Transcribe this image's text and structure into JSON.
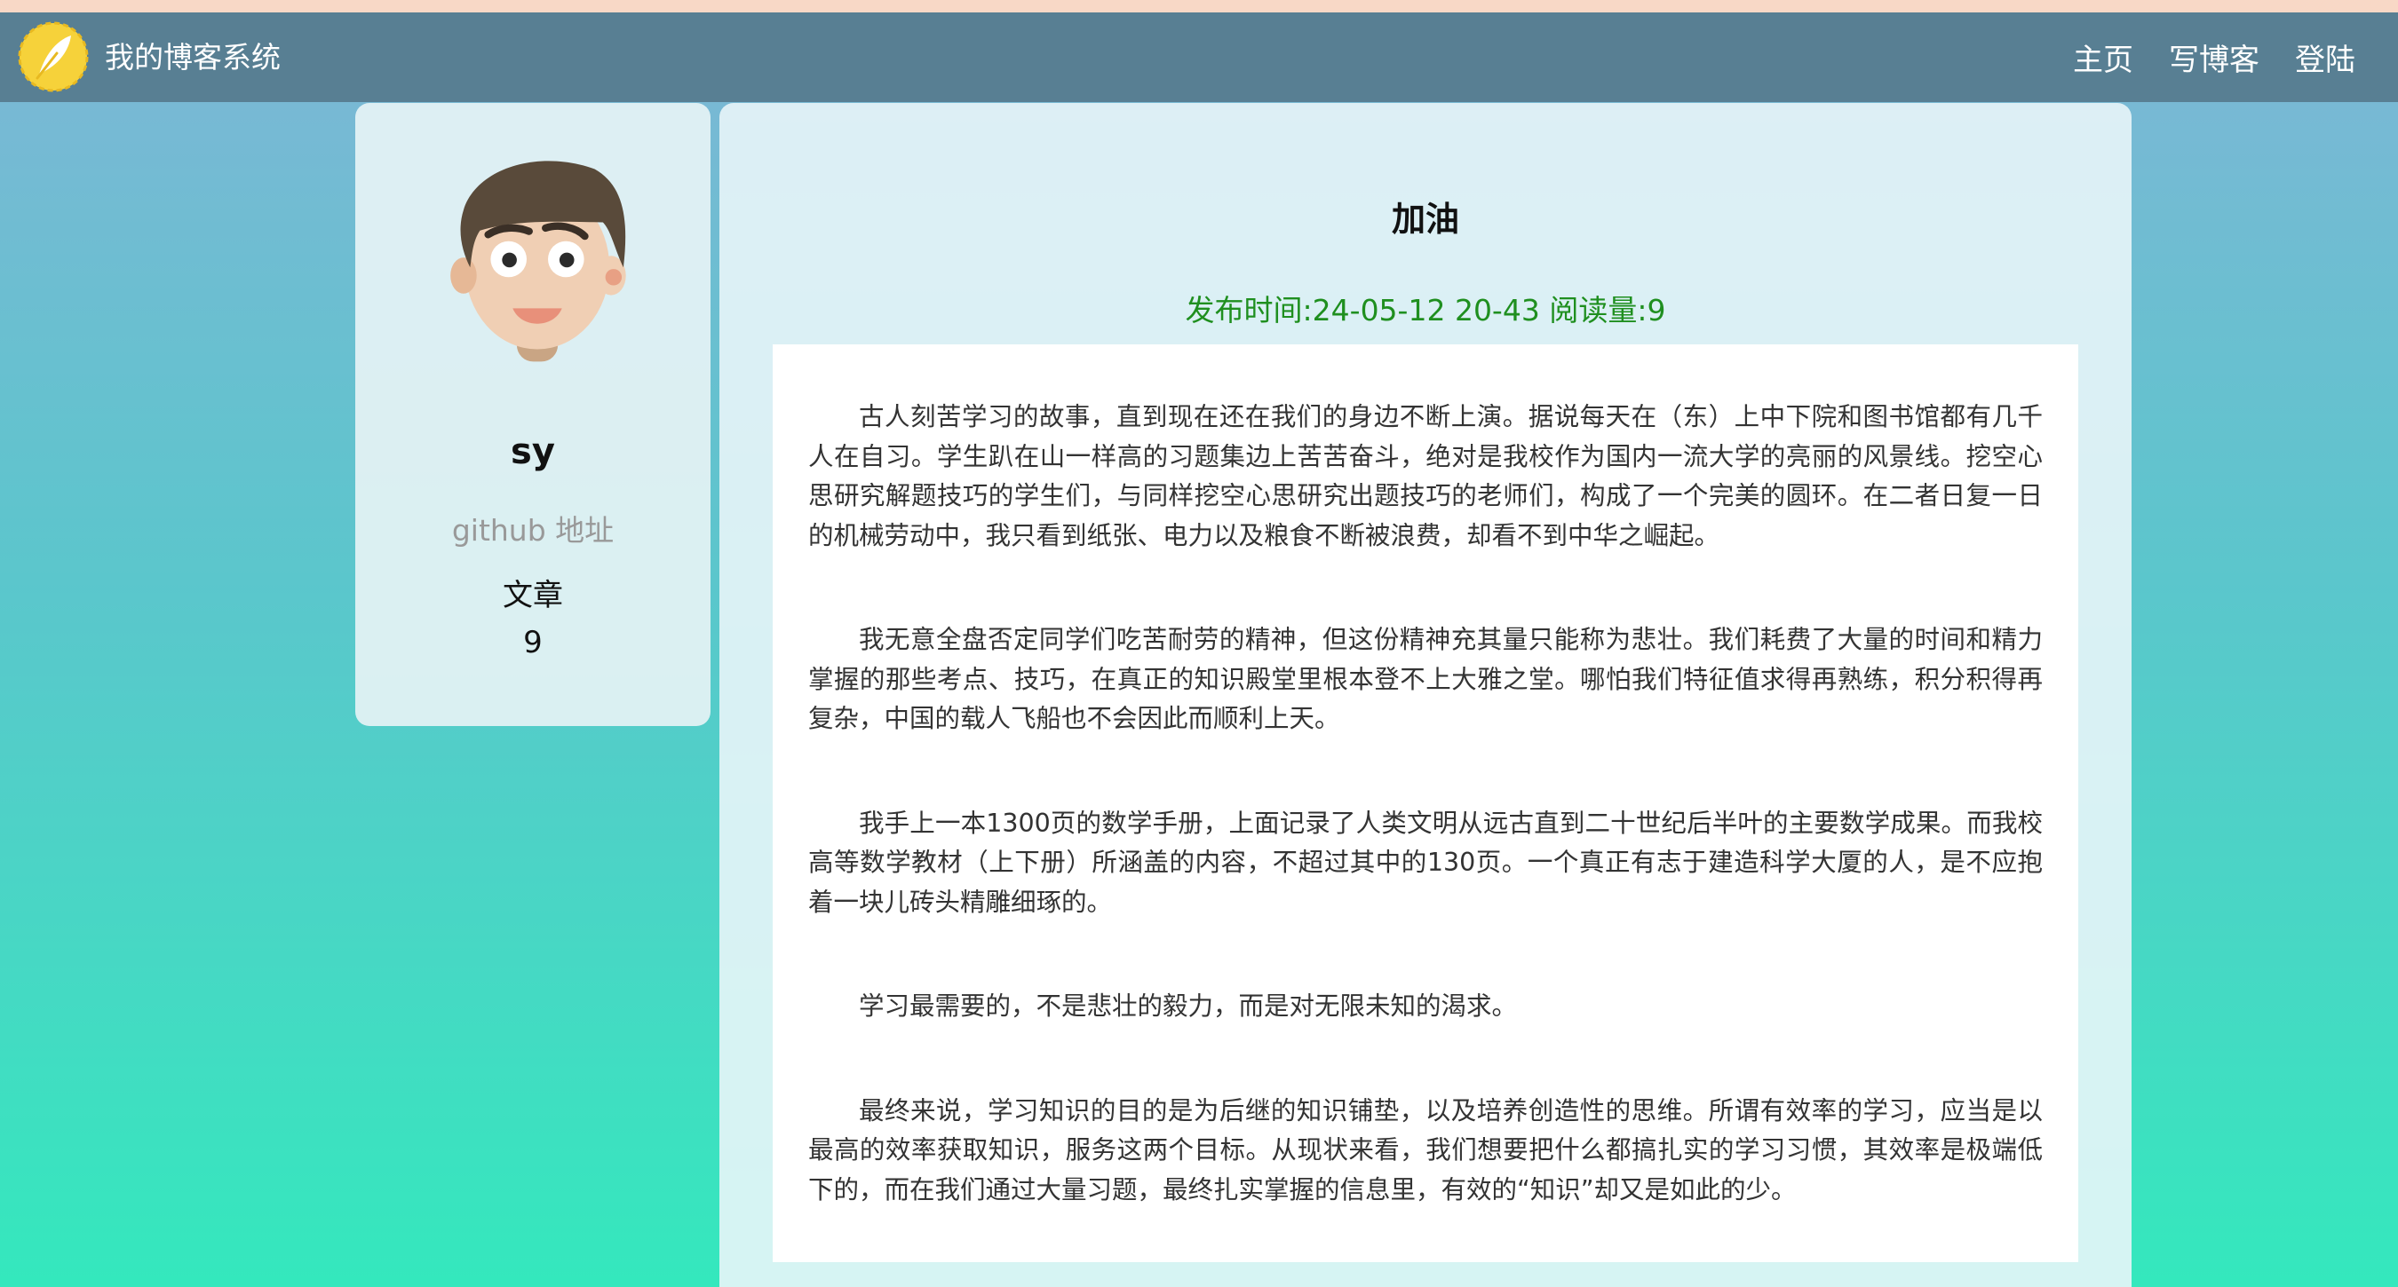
{
  "navbar": {
    "site_title": "我的博客系统",
    "links": [
      "主页",
      "写博客",
      "登陆"
    ],
    "logo_icon": "feather-logo-icon"
  },
  "profile": {
    "name": "sy",
    "github": "github 地址",
    "articles_label": "文章",
    "articles_count": "9",
    "avatar_icon": "cartoon-avatar-icon"
  },
  "article": {
    "title": "加油",
    "meta": "发布时间:24-05-12 20-43 阅读量:9",
    "paragraphs": [
      "古人刻苦学习的故事，直到现在还在我们的身边不断上演。据说每天在（东）上中下院和图书馆都有几千人在自习。学生趴在山一样高的习题集边上苦苦奋斗，绝对是我校作为国内一流大学的亮丽的风景线。挖空心思研究解题技巧的学生们，与同样挖空心思研究出题技巧的老师们，构成了一个完美的圆环。在二者日复一日的机械劳动中，我只看到纸张、电力以及粮食不断被浪费，却看不到中华之崛起。",
      "我无意全盘否定同学们吃苦耐劳的精神，但这份精神充其量只能称为悲壮。我们耗费了大量的时间和精力掌握的那些考点、技巧，在真正的知识殿堂里根本登不上大雅之堂。哪怕我们特征值求得再熟练，积分积得再复杂，中国的载人飞船也不会因此而顺利上天。",
      "我手上一本1300页的数学手册，上面记录了人类文明从远古直到二十世纪后半叶的主要数学成果。而我校高等数学教材（上下册）所涵盖的内容，不超过其中的130页。一个真正有志于建造科学大厦的人，是不应抱着一块儿砖头精雕细琢的。",
      "学习最需要的，不是悲壮的毅力，而是对无限未知的渴求。",
      "最终来说，学习知识的目的是为后继的知识铺垫，以及培养创造性的思维。所谓有效率的学习，应当是以最高的效率获取知识，服务这两个目标。从现状来看，我们想要把什么都搞扎实的学习习惯，其效率是极端低下的，而在我们通过大量习题，最终扎实掌握的信息里，有效的“知识”却又是如此的少。"
    ]
  },
  "colors": {
    "navbar_bg": "#587f93",
    "meta_text": "#1f8f1f",
    "github_text": "#999999"
  }
}
